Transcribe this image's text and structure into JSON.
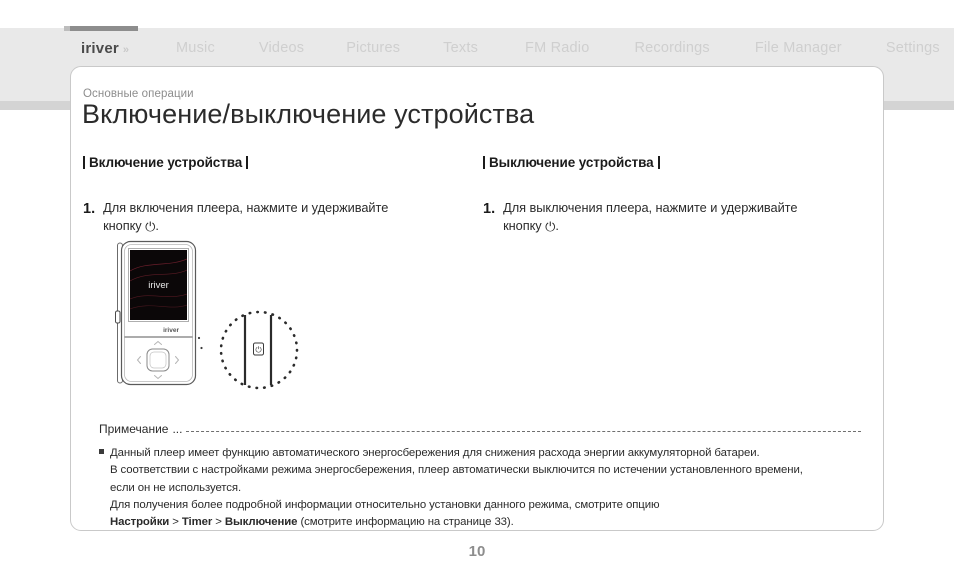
{
  "nav": {
    "brand": "iriver",
    "brand_chevrons": "»",
    "items": [
      {
        "label": "Music"
      },
      {
        "label": "Videos"
      },
      {
        "label": "Pictures"
      },
      {
        "label": "Texts"
      },
      {
        "label": "FM Radio"
      },
      {
        "label": "Recordings"
      },
      {
        "label": "File Manager"
      },
      {
        "label": "Settings"
      }
    ],
    "active": "iriver"
  },
  "card": {
    "breadcrumb": "Основные операции",
    "title": "Включение/выключение устройства"
  },
  "columns": {
    "left": {
      "heading": "Включение устройства",
      "step_number": "1.",
      "step_text_line1": "Для включения плеера, нажмите и удерживайте",
      "step_text_line2_prefix": "кнопку ",
      "power_icon": "⏻",
      "step_text_line2_suffix": "."
    },
    "right": {
      "heading": "Выключение устройства",
      "step_number": "1.",
      "step_text_line1": "Для выключения плеера, нажмите и удерживайте",
      "step_text_line2_prefix": "кнопку ",
      "power_icon": "⏻",
      "step_text_line2_suffix": "."
    }
  },
  "device": {
    "screen_logo": "iriver",
    "body_logo": "iriver",
    "callout_label": "power-button-side-view"
  },
  "note": {
    "label": "Примечание",
    "label_ellipsis": "...",
    "line1": "Данный плеер имеет функцию автоматического энергосбережения для снижения расхода энергии аккумуляторной батареи.",
    "line2": "В соответствии с настройками режима энергосбережения, плеер автоматически выключится по истечении установленного времени,",
    "line3": "если он не используется.",
    "line4": "Для получения более подробной информации относительно установки данного режима, смотрите опцию",
    "path_1": "Настройки",
    "path_sep_1": " > ",
    "path_2": "Timer",
    "path_sep_2": " > ",
    "path_3": "Выключение",
    "path_tail": " (смотрите информацию на странице 33)."
  },
  "footer": {
    "page_number": "10"
  },
  "colors": {
    "nav_band": "#e9e9e9",
    "nav_band_lower": "#d4d4d4",
    "nav_inactive_text": "#cfcfcf",
    "brand_text": "#4a4a4a",
    "active_indicator": "#8d8d8d",
    "card_border": "#c9c9c9",
    "title_text": "#2b2b2b",
    "breadcrumb_text": "#8d8d8d",
    "body_text": "#2b2b2b",
    "page_number": "#8d8d8d",
    "device_screen": "#0b0708",
    "device_screen_wave": "#7a2230"
  }
}
